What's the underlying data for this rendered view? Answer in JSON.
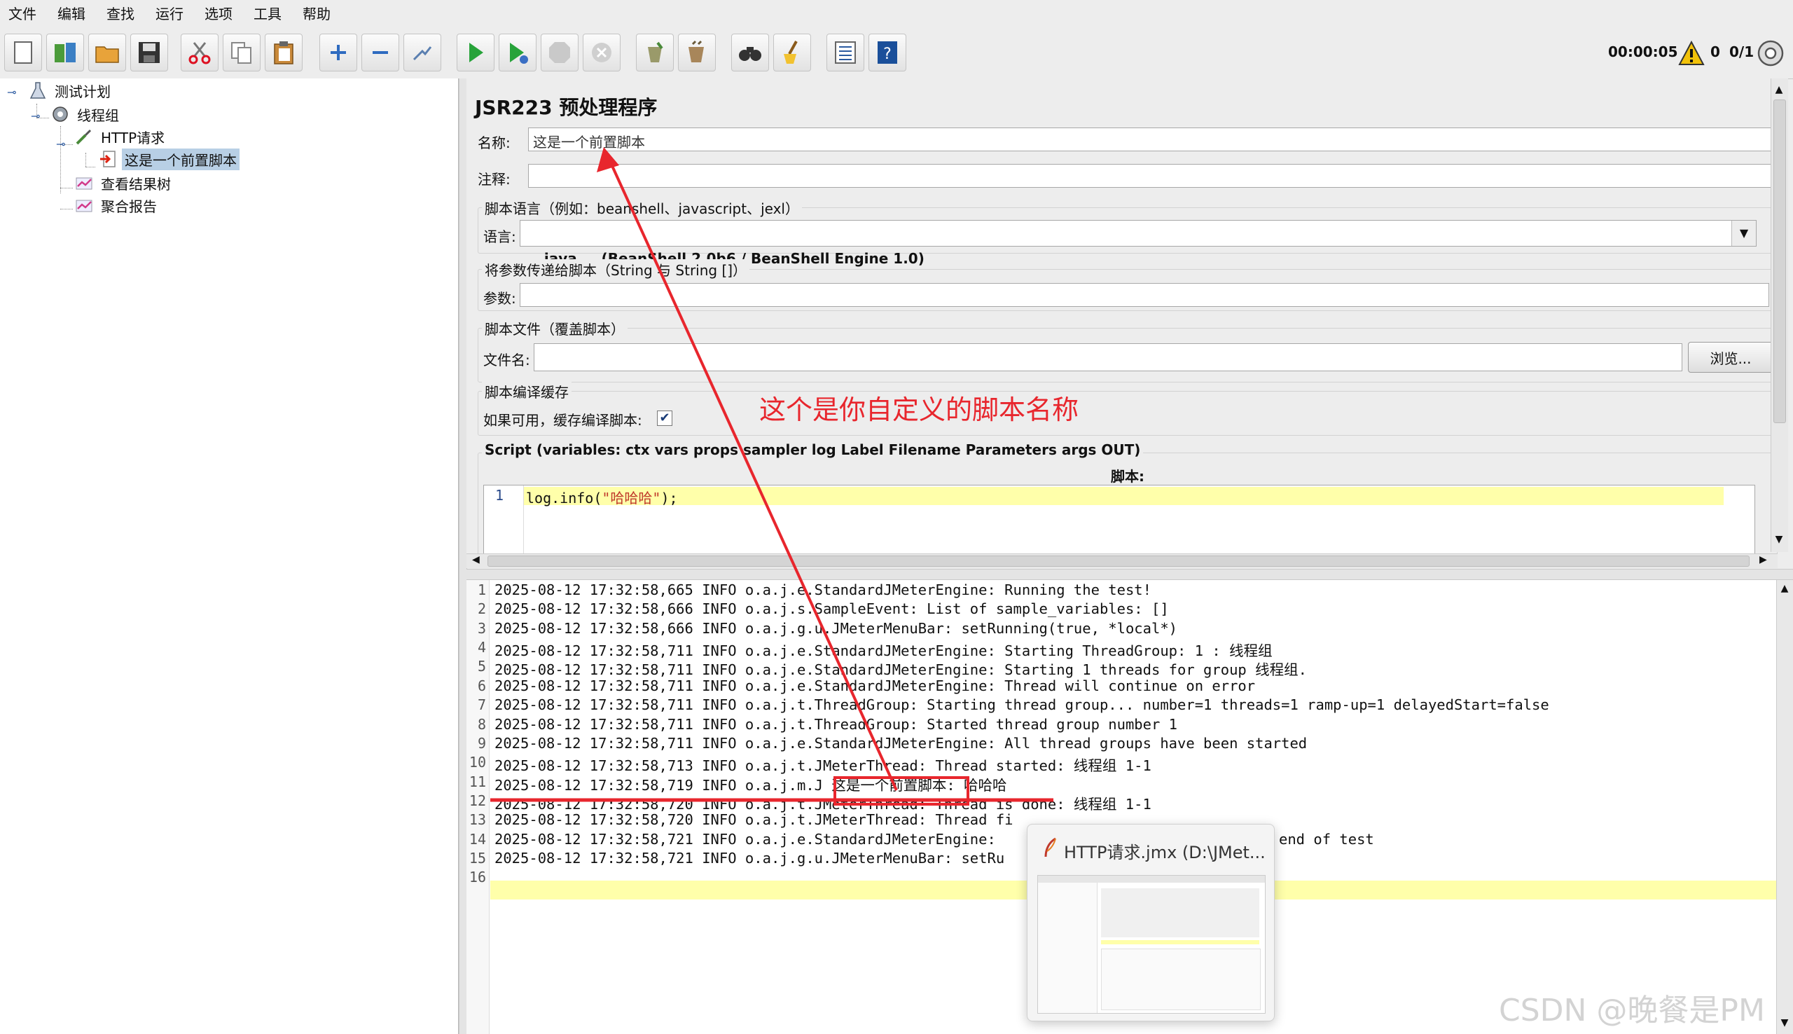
{
  "menubar": {
    "items": [
      "文件",
      "编辑",
      "查找",
      "运行",
      "选项",
      "工具",
      "帮助"
    ]
  },
  "toolbar": {
    "buttons": [
      {
        "icon": "new-icon"
      },
      {
        "icon": "templates-icon"
      },
      {
        "icon": "open-icon"
      },
      {
        "icon": "save-icon"
      },
      {
        "icon": "cut-icon"
      },
      {
        "icon": "copy-icon"
      },
      {
        "icon": "paste-icon"
      },
      {
        "icon": "expand-icon"
      },
      {
        "icon": "collapse-icon"
      },
      {
        "icon": "toggle-icon"
      },
      {
        "icon": "start-icon"
      },
      {
        "icon": "start-no-pause-icon"
      },
      {
        "icon": "stop-icon"
      },
      {
        "icon": "shutdown-icon"
      },
      {
        "icon": "clear-icon"
      },
      {
        "icon": "clear-all-icon"
      },
      {
        "icon": "search-icon"
      },
      {
        "icon": "reset-search-icon"
      },
      {
        "icon": "function-helper-icon"
      },
      {
        "icon": "help-icon"
      }
    ],
    "elapsed_time": "00:00:05",
    "warning_count": "0",
    "threads": "0/1"
  },
  "tree": {
    "nodes": [
      {
        "label": "测试计划",
        "icon": "test-plan-icon"
      },
      {
        "label": "线程组",
        "icon": "gear-icon"
      },
      {
        "label": "HTTP请求",
        "icon": "pipette-icon"
      },
      {
        "label": "这是一个前置脚本",
        "icon": "preprocessor-icon",
        "selected": true
      },
      {
        "label": "查看结果树",
        "icon": "listener-icon"
      },
      {
        "label": "聚合报告",
        "icon": "listener-icon"
      }
    ]
  },
  "panel": {
    "title": "JSR223 预处理程序",
    "name_label": "名称:",
    "name_value": "这是一个前置脚本",
    "comment_label": "注释:",
    "comment_value": "",
    "lang_group_title": "脚本语言（例如：beanshell、javascript、jexl）",
    "lang_label": "语言:",
    "lang_value": "java     (BeanShell 2.0b6 / BeanShell Engine 1.0)",
    "params_group_title": "将参数传递给脚本（String 与 String []）",
    "params_label": "参数:",
    "params_value": "",
    "file_group_title": "脚本文件（覆盖脚本）",
    "file_label": "文件名:",
    "file_value": "",
    "browse_label": "浏览...",
    "cache_group_title": "脚本编译缓存",
    "cache_label": "如果可用，缓存编译脚本:",
    "cache_checked": true,
    "script_group_title": "Script (variables: ctx vars props sampler log Label Filename Parameters args OUT)",
    "script_label": "脚本:",
    "script_lines": [
      {
        "num": "1",
        "code_prefix": "log.info(",
        "code_string": "\"哈哈哈\"",
        "code_suffix": ");"
      }
    ]
  },
  "log": {
    "lines": [
      "2025-08-12 17:32:58,665 INFO o.a.j.e.StandardJMeterEngine: Running the test!",
      "2025-08-12 17:32:58,666 INFO o.a.j.s.SampleEvent: List of sample_variables: []",
      "2025-08-12 17:32:58,666 INFO o.a.j.g.u.JMeterMenuBar: setRunning(true, *local*)",
      "2025-08-12 17:32:58,711 INFO o.a.j.e.StandardJMeterEngine: Starting ThreadGroup: 1 : 线程组",
      "2025-08-12 17:32:58,711 INFO o.a.j.e.StandardJMeterEngine: Starting 1 threads for group 线程组.",
      "2025-08-12 17:32:58,711 INFO o.a.j.e.StandardJMeterEngine: Thread will continue on error",
      "2025-08-12 17:32:58,711 INFO o.a.j.t.ThreadGroup: Starting thread group... number=1 threads=1 ramp-up=1 delayedStart=false",
      "2025-08-12 17:32:58,711 INFO o.a.j.t.ThreadGroup: Started thread group number 1",
      "2025-08-12 17:32:58,711 INFO o.a.j.e.StandardJMeterEngine: All thread groups have been started",
      "2025-08-12 17:32:58,713 INFO o.a.j.t.JMeterThread: Thread started: 线程组 1-1",
      "2025-08-12 17:32:58,719 INFO o.a.j.m.J 这是一个前置脚本: 哈哈哈",
      "2025-08-12 17:32:58,720 INFO o.a.j.t.JMeterThread: Thread is done: 线程组 1-1",
      "2025-08-12 17:32:58,720 INFO o.a.j.t.JMeterThread: Thread fi",
      "2025-08-12 17:32:58,721 INFO o.a.j.e.StandardJMeterEngine: ",
      "2025-08-12 17:32:58,721 INFO o.a.j.g.u.JMeterMenuBar: setRu",
      ""
    ],
    "line14_tail": "end of test",
    "current_line": "16"
  },
  "annotation": {
    "text": "这个是你自定义的脚本名称",
    "color": "#e8262d"
  },
  "taskbar_preview": {
    "title": "HTTP请求.jmx (D:\\JMet..."
  },
  "watermark": "CSDN @晚餐是PM",
  "colors": {
    "selection": "#b8cfe5",
    "current_line": "#ffffaa",
    "annotation": "#e8262d"
  }
}
